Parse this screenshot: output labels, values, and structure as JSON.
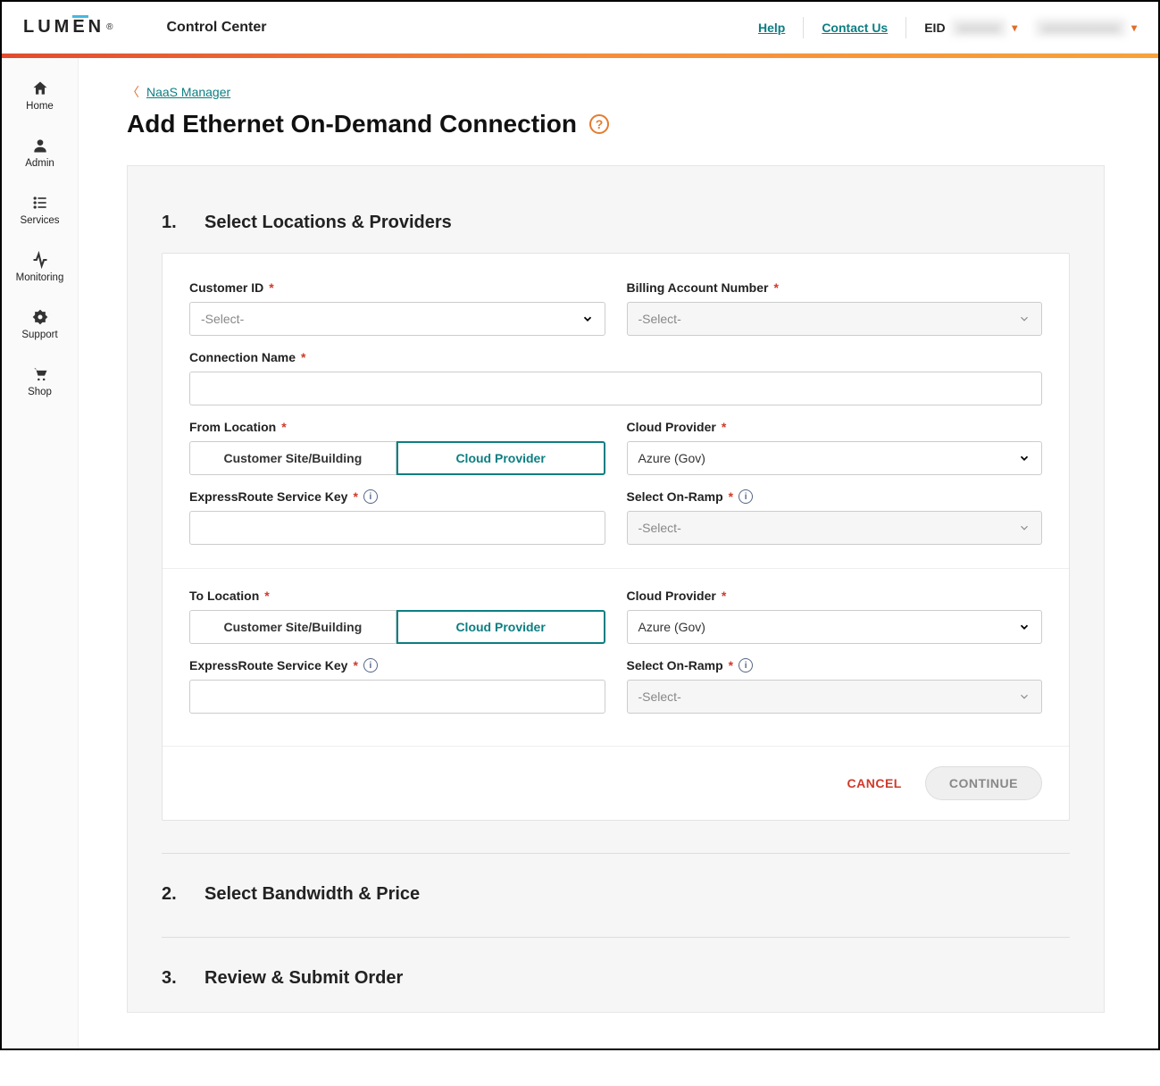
{
  "header": {
    "logo_text": "LUMEN",
    "app_name": "Control Center",
    "help": "Help",
    "contact": "Contact Us",
    "eid_label": "EID"
  },
  "sidebar": {
    "items": [
      {
        "label": "Home"
      },
      {
        "label": "Admin"
      },
      {
        "label": "Services"
      },
      {
        "label": "Monitoring"
      },
      {
        "label": "Support"
      },
      {
        "label": "Shop"
      }
    ]
  },
  "breadcrumb": {
    "label": "NaaS Manager"
  },
  "page_title": "Add Ethernet On-Demand Connection",
  "steps": {
    "s1_num": "1.",
    "s1_title": "Select Locations & Providers",
    "s2_num": "2.",
    "s2_title": "Select Bandwidth & Price",
    "s3_num": "3.",
    "s3_title": "Review & Submit Order"
  },
  "form": {
    "customer_id": {
      "label": "Customer ID",
      "placeholder": "-Select-"
    },
    "ban": {
      "label": "Billing Account Number",
      "placeholder": "-Select-"
    },
    "conn_name": {
      "label": "Connection Name"
    },
    "from_loc": {
      "label": "From Location",
      "opt1": "Customer Site/Building",
      "opt2": "Cloud Provider"
    },
    "cloud_provider_a": {
      "label": "Cloud Provider",
      "value": "Azure (Gov)"
    },
    "er_key_a": {
      "label": "ExpressRoute Service Key"
    },
    "onramp_a": {
      "label": "Select On-Ramp",
      "placeholder": "-Select-"
    },
    "to_loc": {
      "label": "To Location",
      "opt1": "Customer Site/Building",
      "opt2": "Cloud Provider"
    },
    "cloud_provider_b": {
      "label": "Cloud Provider",
      "value": "Azure (Gov)"
    },
    "er_key_b": {
      "label": "ExpressRoute Service Key"
    },
    "onramp_b": {
      "label": "Select On-Ramp",
      "placeholder": "-Select-"
    }
  },
  "actions": {
    "cancel": "CANCEL",
    "continue": "CONTINUE"
  }
}
